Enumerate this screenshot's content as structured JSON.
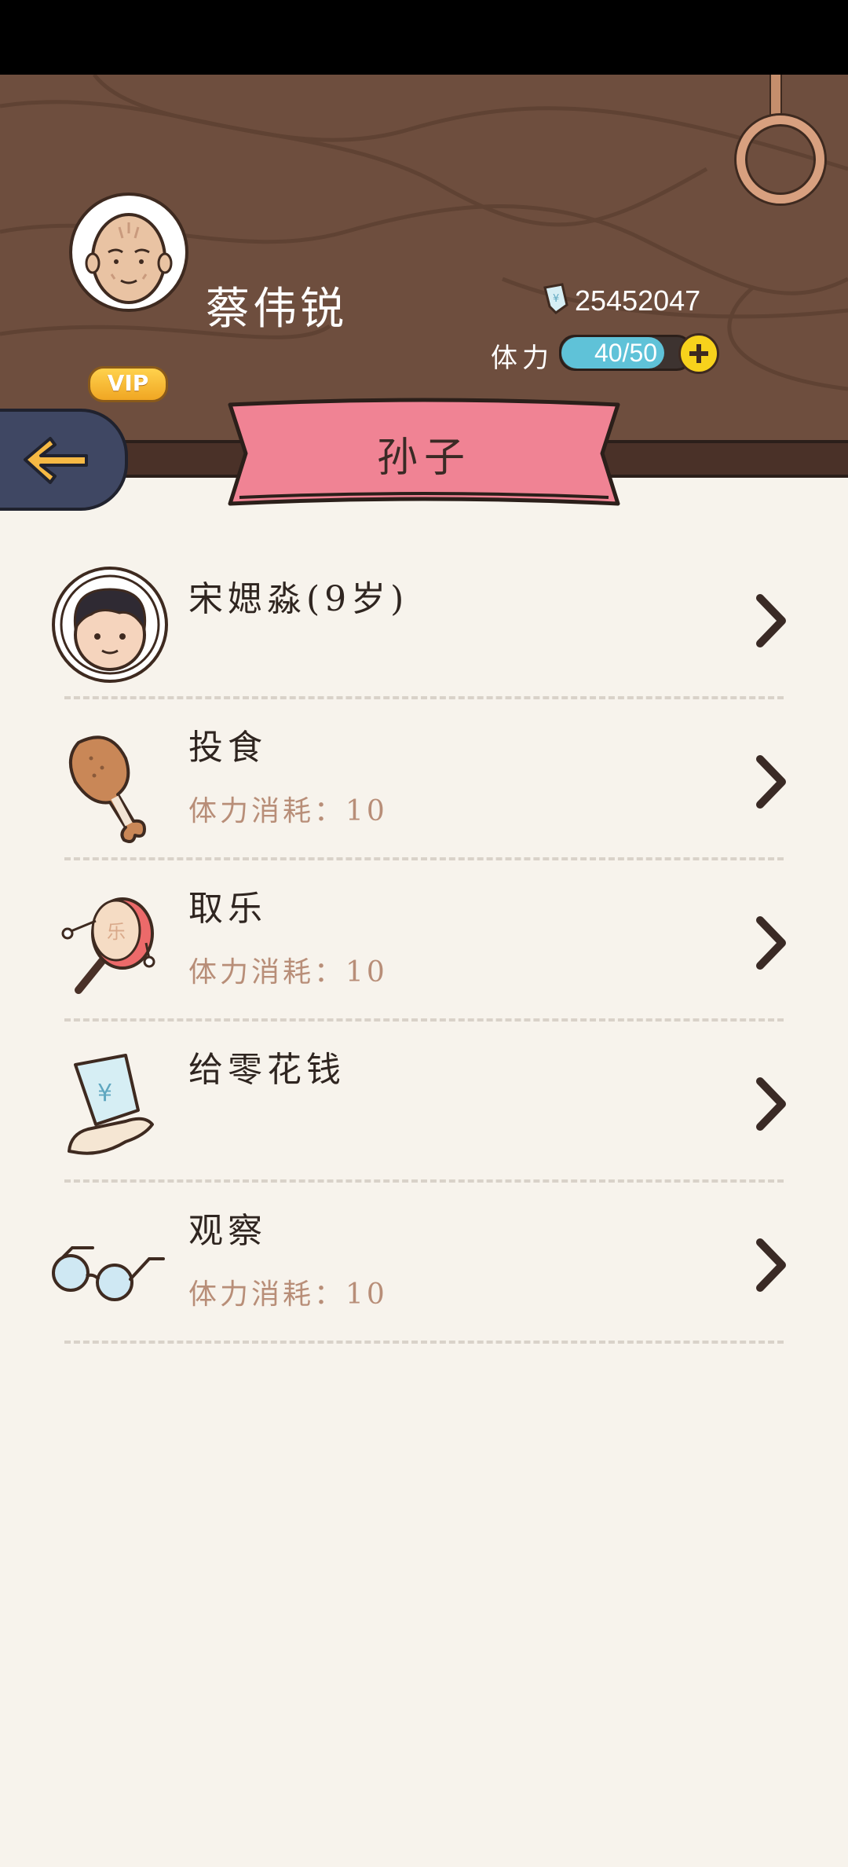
{
  "player": {
    "name": "蔡伟锐",
    "vip_label": "VIP",
    "money": "25452047",
    "stamina_label": "体力",
    "stamina_text": "40/50",
    "stamina_fraction": 0.8
  },
  "page": {
    "title": "孙子"
  },
  "grandchild": {
    "name": "宋媤淼(9岁)"
  },
  "actions": [
    {
      "title": "投食",
      "cost": "体力消耗：10",
      "icon": "chicken-leg-icon"
    },
    {
      "title": "取乐",
      "cost": "体力消耗：10",
      "icon": "rattle-drum-icon"
    },
    {
      "title": "给零花钱",
      "cost": "",
      "icon": "money-hand-icon"
    },
    {
      "title": "观察",
      "cost": "体力消耗：10",
      "icon": "glasses-icon"
    }
  ],
  "colors": {
    "wood": "#6e4e3e",
    "ribbon": "#f08394",
    "stamina": "#5fc2d8",
    "background": "#f7f3ec"
  }
}
